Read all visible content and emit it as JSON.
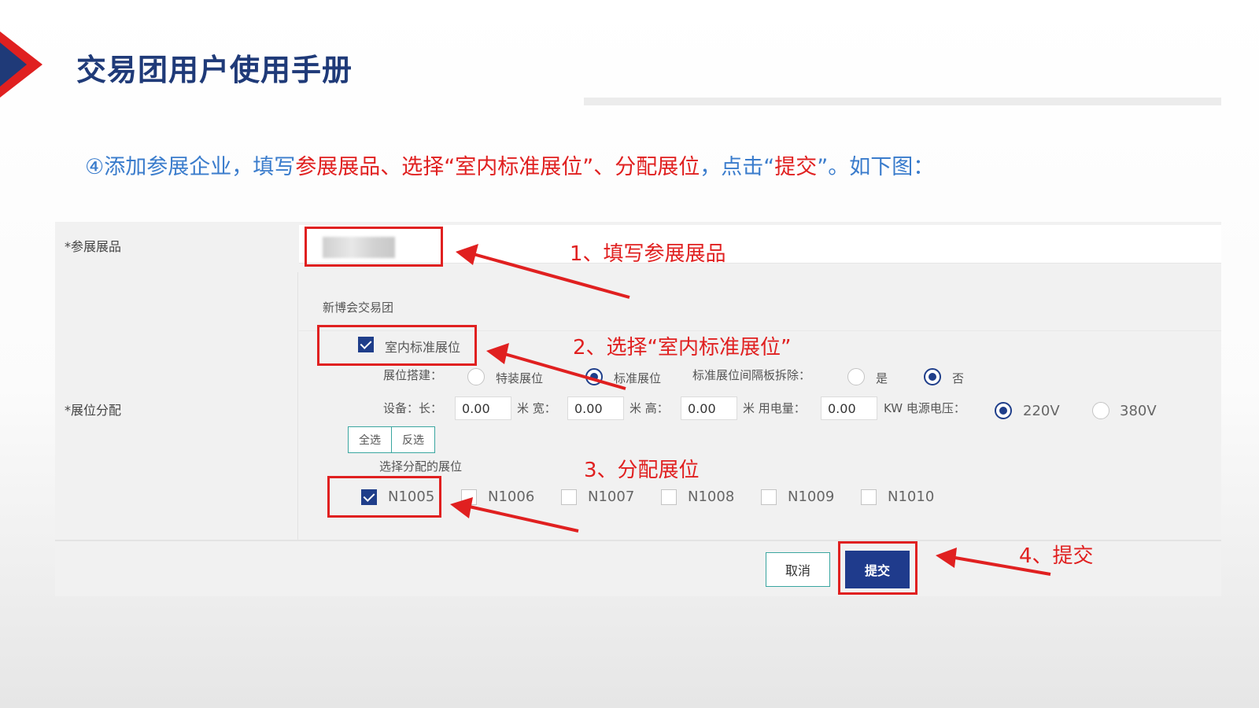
{
  "slide": {
    "title": "交易团用户使用手册",
    "accent_colors": {
      "red": "#e02020",
      "navy": "#1f3a78"
    }
  },
  "instruction": {
    "p1": "④添加参展企业，填写",
    "p2": "参展展品、选择“室内标准展位”、分配展位",
    "p3": "，点击“",
    "p4": "提交",
    "p5": "”。如下图："
  },
  "form": {
    "exhibit_label": "*参展展品",
    "booth_label": "*展位分配",
    "group_name": "新博会交易团",
    "indoor_standard_label": "室内标准展位",
    "indoor_standard_checked": true,
    "build": {
      "label": "展位搭建：",
      "options": [
        "特装展位",
        "标准展位"
      ],
      "selected": "标准展位"
    },
    "partition": {
      "label": "标准展位间隔板拆除：",
      "options": [
        "是",
        "否"
      ],
      "selected": "否"
    },
    "equipment": {
      "label": "设备：长：",
      "length": "0.00",
      "unit_m1": "米 宽：",
      "width": "0.00",
      "unit_m2": "米 高：",
      "height": "0.00",
      "unit_m3": "米 用电量：",
      "power": "0.00",
      "unit_kw": "KW 电源电压：",
      "voltage_options": [
        "220V",
        "380V"
      ],
      "voltage_selected": "220V"
    },
    "select_all": "全选",
    "invert": "反选",
    "booths_label": "选择分配的展位",
    "booths": [
      {
        "id": "N1005",
        "checked": true
      },
      {
        "id": "N1006",
        "checked": false
      },
      {
        "id": "N1007",
        "checked": false
      },
      {
        "id": "N1008",
        "checked": false
      },
      {
        "id": "N1009",
        "checked": false
      },
      {
        "id": "N1010",
        "checked": false
      }
    ],
    "cancel": "取消",
    "submit": "提交"
  },
  "annotations": {
    "step1": "1、填写参展展品",
    "step2": "2、选择“室内标准展位”",
    "step3": "3、分配展位",
    "step4": "4、提交"
  }
}
